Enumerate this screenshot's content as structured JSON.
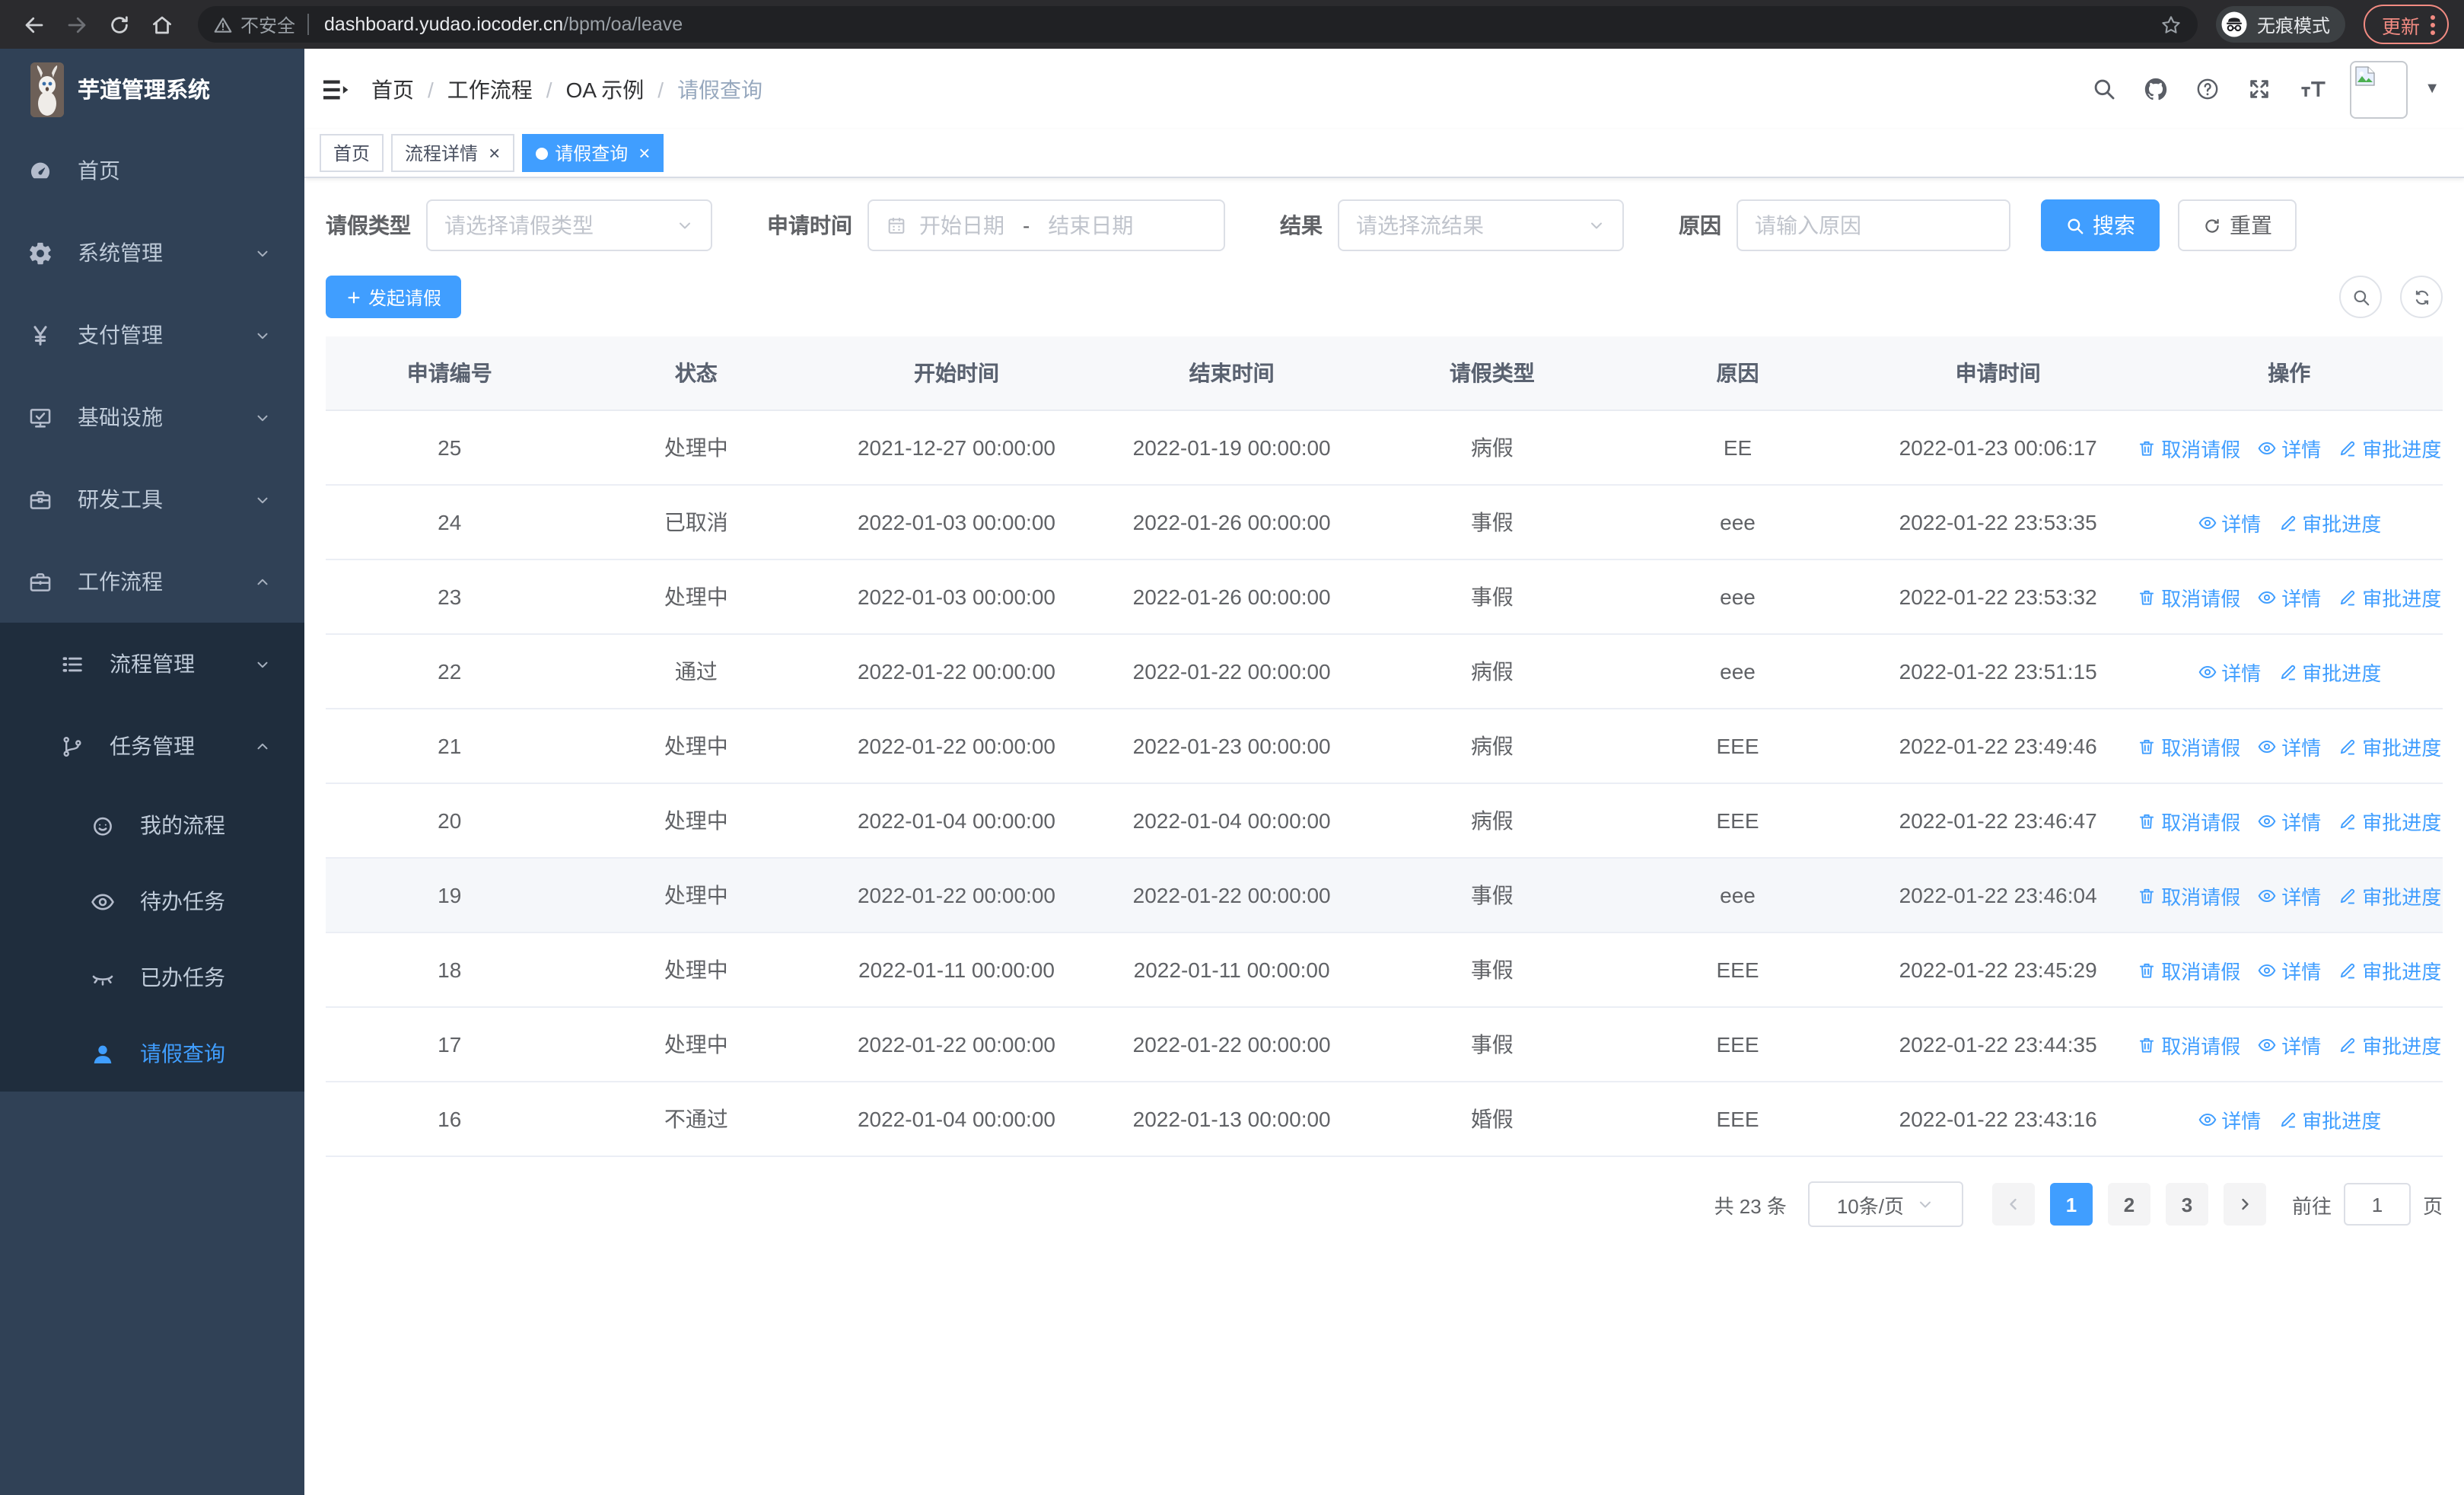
{
  "browser": {
    "security_label": "不安全",
    "url_host": "dashboard.yudao.iocoder.cn",
    "url_path": "/bpm/oa/leave",
    "incognito_label": "无痕模式",
    "update_label": "更新"
  },
  "sidebar": {
    "title": "芋道管理系统",
    "items": [
      {
        "name": "home",
        "label": "首页",
        "icon": "dashboard",
        "level": 1
      },
      {
        "name": "system",
        "label": "系统管理",
        "icon": "gear",
        "level": 1,
        "arrow": "down"
      },
      {
        "name": "payment",
        "label": "支付管理",
        "icon": "yen",
        "level": 1,
        "arrow": "down"
      },
      {
        "name": "infra",
        "label": "基础设施",
        "icon": "monitor",
        "level": 1,
        "arrow": "down"
      },
      {
        "name": "devtools",
        "label": "研发工具",
        "icon": "toolbox",
        "level": 1,
        "arrow": "down"
      },
      {
        "name": "workflow",
        "label": "工作流程",
        "icon": "briefcase",
        "level": 1,
        "arrow": "up"
      },
      {
        "name": "process-mgmt",
        "label": "流程管理",
        "icon": "list",
        "level": 2,
        "arrow": "down",
        "sub": true
      },
      {
        "name": "task-mgmt",
        "label": "任务管理",
        "icon": "branch",
        "level": 2,
        "arrow": "up",
        "sub": true
      },
      {
        "name": "my-process",
        "label": "我的流程",
        "icon": "face",
        "level": 3,
        "sub": true
      },
      {
        "name": "todo-tasks",
        "label": "待办任务",
        "icon": "eye",
        "level": 3,
        "sub": true
      },
      {
        "name": "done-tasks",
        "label": "已办任务",
        "icon": "eye-closed",
        "level": 3,
        "sub": true
      },
      {
        "name": "leave-query",
        "label": "请假查询",
        "icon": "user",
        "level": 3,
        "sub": true,
        "active": true
      }
    ]
  },
  "header": {
    "breadcrumb": [
      "首页",
      "工作流程",
      "OA 示例",
      "请假查询"
    ]
  },
  "tabs": [
    {
      "name": "home",
      "label": "首页"
    },
    {
      "name": "process-detail",
      "label": "流程详情",
      "closable": true
    },
    {
      "name": "leave-query",
      "label": "请假查询",
      "closable": true,
      "active": true
    }
  ],
  "filters": {
    "leave_type_label": "请假类型",
    "leave_type_placeholder": "请选择请假类型",
    "apply_time_label": "申请时间",
    "start_placeholder": "开始日期",
    "range_separator": "-",
    "end_placeholder": "结束日期",
    "result_label": "结果",
    "result_placeholder": "请选择流结果",
    "reason_label": "原因",
    "reason_placeholder": "请输入原因",
    "search_label": "搜索",
    "reset_label": "重置"
  },
  "toolbar": {
    "create_label": "发起请假"
  },
  "table": {
    "headers": [
      "申请编号",
      "状态",
      "开始时间",
      "结束时间",
      "请假类型",
      "原因",
      "申请时间",
      "操作"
    ],
    "action_labels": {
      "cancel": "取消请假",
      "detail": "详情",
      "progress": "审批进度"
    },
    "rows": [
      {
        "id": "25",
        "status": "处理中",
        "start": "2021-12-27 00:00:00",
        "end": "2022-01-19 00:00:00",
        "type": "病假",
        "reason": "EE",
        "applied": "2022-01-23 00:06:17",
        "actions": [
          "cancel",
          "detail",
          "progress"
        ]
      },
      {
        "id": "24",
        "status": "已取消",
        "start": "2022-01-03 00:00:00",
        "end": "2022-01-26 00:00:00",
        "type": "事假",
        "reason": "eee",
        "applied": "2022-01-22 23:53:35",
        "actions": [
          "detail",
          "progress"
        ]
      },
      {
        "id": "23",
        "status": "处理中",
        "start": "2022-01-03 00:00:00",
        "end": "2022-01-26 00:00:00",
        "type": "事假",
        "reason": "eee",
        "applied": "2022-01-22 23:53:32",
        "actions": [
          "cancel",
          "detail",
          "progress"
        ]
      },
      {
        "id": "22",
        "status": "通过",
        "start": "2022-01-22 00:00:00",
        "end": "2022-01-22 00:00:00",
        "type": "病假",
        "reason": "eee",
        "applied": "2022-01-22 23:51:15",
        "actions": [
          "detail",
          "progress"
        ]
      },
      {
        "id": "21",
        "status": "处理中",
        "start": "2022-01-22 00:00:00",
        "end": "2022-01-23 00:00:00",
        "type": "病假",
        "reason": "EEE",
        "applied": "2022-01-22 23:49:46",
        "actions": [
          "cancel",
          "detail",
          "progress"
        ]
      },
      {
        "id": "20",
        "status": "处理中",
        "start": "2022-01-04 00:00:00",
        "end": "2022-01-04 00:00:00",
        "type": "病假",
        "reason": "EEE",
        "applied": "2022-01-22 23:46:47",
        "actions": [
          "cancel",
          "detail",
          "progress"
        ]
      },
      {
        "id": "19",
        "status": "处理中",
        "start": "2022-01-22 00:00:00",
        "end": "2022-01-22 00:00:00",
        "type": "事假",
        "reason": "eee",
        "applied": "2022-01-22 23:46:04",
        "actions": [
          "cancel",
          "detail",
          "progress"
        ],
        "highlight": true
      },
      {
        "id": "18",
        "status": "处理中",
        "start": "2022-01-11 00:00:00",
        "end": "2022-01-11 00:00:00",
        "type": "事假",
        "reason": "EEE",
        "applied": "2022-01-22 23:45:29",
        "actions": [
          "cancel",
          "detail",
          "progress"
        ]
      },
      {
        "id": "17",
        "status": "处理中",
        "start": "2022-01-22 00:00:00",
        "end": "2022-01-22 00:00:00",
        "type": "事假",
        "reason": "EEE",
        "applied": "2022-01-22 23:44:35",
        "actions": [
          "cancel",
          "detail",
          "progress"
        ]
      },
      {
        "id": "16",
        "status": "不通过",
        "start": "2022-01-04 00:00:00",
        "end": "2022-01-13 00:00:00",
        "type": "婚假",
        "reason": "EEE",
        "applied": "2022-01-22 23:43:16",
        "actions": [
          "detail",
          "progress"
        ]
      }
    ]
  },
  "pagination": {
    "total": "共 23 条",
    "page_size": "10条/页",
    "pages": [
      "1",
      "2",
      "3"
    ],
    "active_page": "1",
    "goto_label": "前往",
    "goto_value": "1",
    "unit_label": "页"
  },
  "colors": {
    "accent": "#409eff",
    "sidebar_bg": "#304156",
    "submenu_bg": "#1f2d3d",
    "update_red": "#f28b82"
  }
}
